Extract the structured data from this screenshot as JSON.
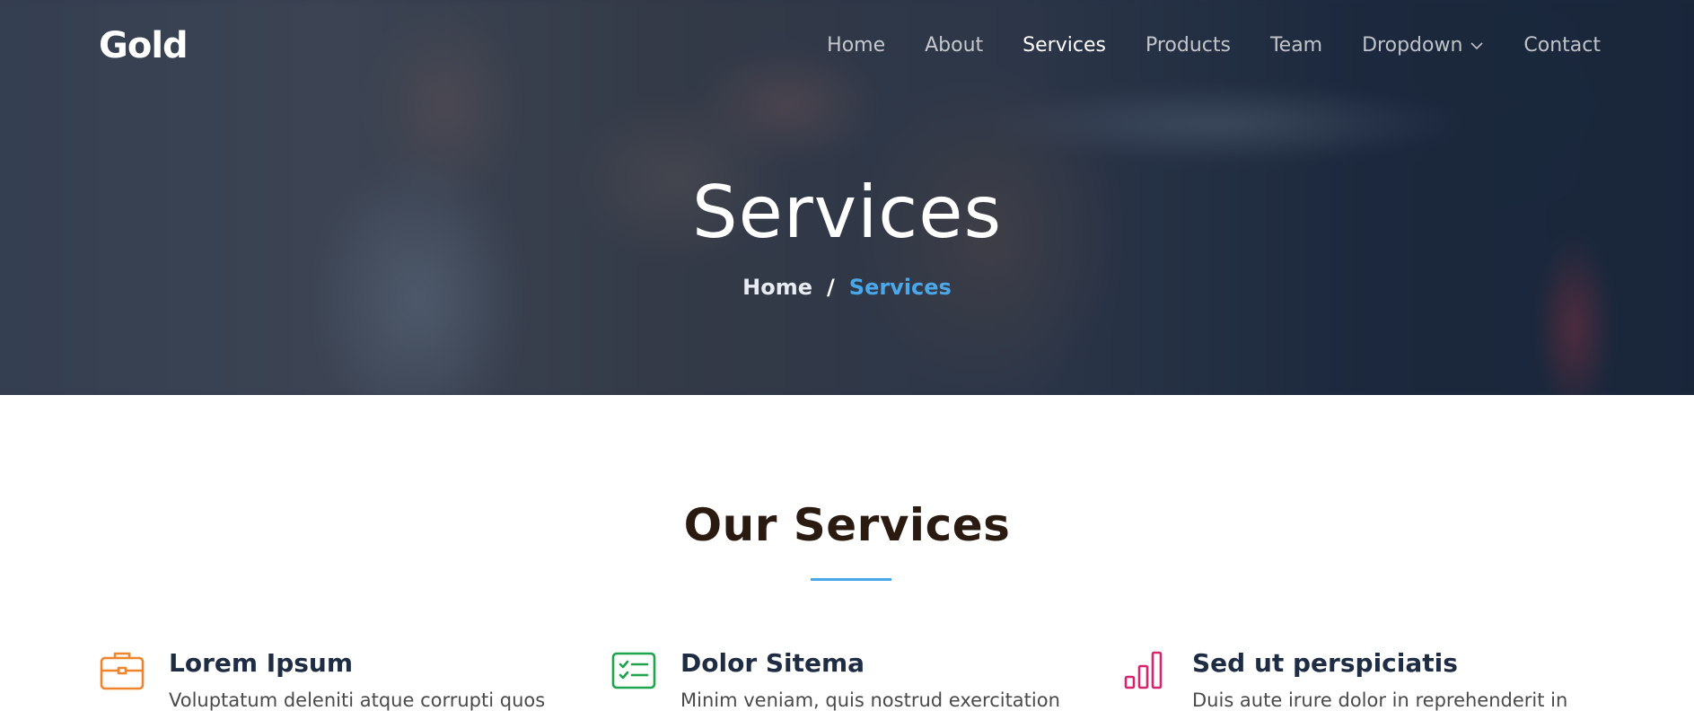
{
  "header": {
    "logo": "Gold",
    "nav": [
      {
        "label": "Home"
      },
      {
        "label": "About"
      },
      {
        "label": "Services"
      },
      {
        "label": "Products"
      },
      {
        "label": "Team"
      },
      {
        "label": "Dropdown"
      },
      {
        "label": "Contact"
      }
    ],
    "active_nav": "Services"
  },
  "hero": {
    "title": "Services",
    "breadcrumb": {
      "home": "Home",
      "separator": "/",
      "current": "Services"
    }
  },
  "services_section": {
    "title": "Our Services",
    "accent_color": "#4aa8ea",
    "items": [
      {
        "icon": "briefcase-icon",
        "icon_color": "#f0842a",
        "title": "Lorem Ipsum",
        "description": "Voluptatum deleniti atque corrupti quos"
      },
      {
        "icon": "checklist-card-icon",
        "icon_color": "#1fa34d",
        "title": "Dolor Sitema",
        "description": "Minim veniam, quis nostrud exercitation"
      },
      {
        "icon": "bar-chart-icon",
        "icon_color": "#d6246e",
        "title": "Sed ut perspiciatis",
        "description": "Duis aute irure dolor in reprehenderit in"
      }
    ]
  }
}
